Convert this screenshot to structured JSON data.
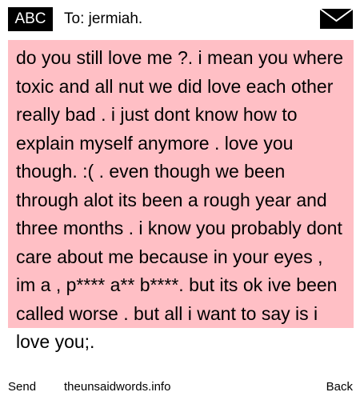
{
  "header": {
    "mode_badge": "ABC",
    "recipient": "To: jermiah.",
    "mail_icon": "envelope-icon"
  },
  "message": {
    "body": "do you still love me ?. i mean you where toxic and all nut we did love each other really bad . i just dont know how to explain myself anymore . love you though. :( . even though we been through alot its been a rough year and three months . i know you probably dont care about me because in your eyes , im a , p**** a** b****. but its ok ive been called worse . but all i want to say is i love you;.",
    "highlight_color": "#ffbfc5"
  },
  "footer": {
    "send_label": "Send",
    "site_label": "theunsaidwords.info",
    "back_label": "Back"
  }
}
